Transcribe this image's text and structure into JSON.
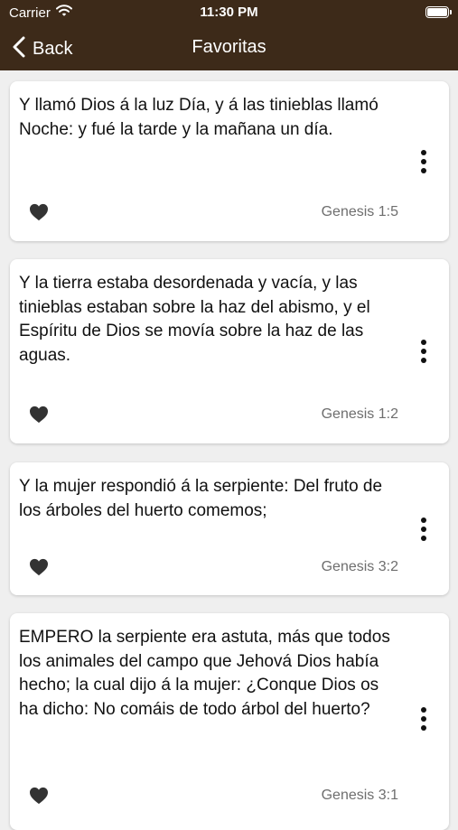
{
  "status_bar": {
    "carrier": "Carrier",
    "time": "11:30 PM"
  },
  "nav": {
    "back_label": "Back",
    "title": "Favoritas"
  },
  "colors": {
    "header_bg": "#3d2a19",
    "page_bg": "#efefef",
    "card_bg": "#ffffff",
    "icon": "#333333",
    "reference_text": "#6e6e6e"
  },
  "favorites": [
    {
      "text": "Y llamó Dios á la luz Día, y á las tinieblas llamó Noche: y fué la tarde y la mañana un día.",
      "reference": "Genesis 1:5"
    },
    {
      "text": "Y la tierra estaba desordenada y vacía, y las tinieblas estaban sobre la haz del abismo, y el Espíritu de Dios se movía sobre la haz de las aguas.",
      "reference": "Genesis 1:2"
    },
    {
      "text": "Y la mujer respondió á la serpiente: Del fruto de los árboles del huerto comemos;",
      "reference": "Genesis 3:2"
    },
    {
      "text": "EMPERO la serpiente era astuta, más que todos los animales del campo que Jehová Dios había hecho; la cual dijo á la mujer: ¿Conque Dios os ha dicho: No comáis de todo árbol del huerto?",
      "reference": "Genesis 3:1"
    }
  ]
}
